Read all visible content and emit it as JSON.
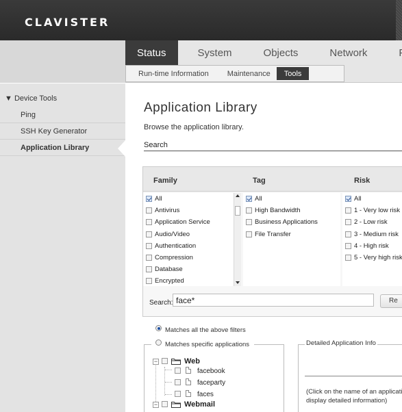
{
  "header": {
    "logo_text": "CLAVISTER"
  },
  "nav": {
    "main_tabs": [
      {
        "label": "Status",
        "active": true
      },
      {
        "label": "System",
        "active": false
      },
      {
        "label": "Objects",
        "active": false
      },
      {
        "label": "Network",
        "active": false
      },
      {
        "label": "Poli",
        "active": false
      }
    ],
    "sub_tabs": [
      {
        "label": "Run-time Information",
        "active": false
      },
      {
        "label": "Maintenance",
        "active": false
      },
      {
        "label": "Tools",
        "active": true
      }
    ]
  },
  "sidebar": {
    "section_title": "▼ Device Tools",
    "items": [
      {
        "label": "Ping",
        "active": false
      },
      {
        "label": "SSH Key Generator",
        "active": false
      },
      {
        "label": "Application Library",
        "active": true
      }
    ]
  },
  "main": {
    "title": "Application Library",
    "description": "Browse the application library.",
    "search_label": "Search"
  },
  "filters": {
    "columns": [
      {
        "header": "Family"
      },
      {
        "header": "Tag"
      },
      {
        "header": "Risk"
      }
    ],
    "family": [
      {
        "label": "All",
        "checked": true
      },
      {
        "label": "Antivirus",
        "checked": false
      },
      {
        "label": "Application Service",
        "checked": false
      },
      {
        "label": "Audio/Video",
        "checked": false
      },
      {
        "label": "Authentication",
        "checked": false
      },
      {
        "label": "Compression",
        "checked": false
      },
      {
        "label": "Database",
        "checked": false
      },
      {
        "label": "Encrypted",
        "checked": false
      }
    ],
    "tag": [
      {
        "label": "All",
        "checked": true
      },
      {
        "label": "High Bandwidth",
        "checked": false
      },
      {
        "label": "Business Applications",
        "checked": false
      },
      {
        "label": "File Transfer",
        "checked": false
      }
    ],
    "risk": [
      {
        "label": "All",
        "checked": true
      },
      {
        "label": "1 - Very low risk",
        "checked": false
      },
      {
        "label": "2 - Low risk",
        "checked": false
      },
      {
        "label": "3 - Medium risk",
        "checked": false
      },
      {
        "label": "4 - High risk",
        "checked": false
      },
      {
        "label": "5 - Very high risk",
        "checked": false
      }
    ],
    "search_label": "Search:",
    "search_value": "face*",
    "reset_label": "Re"
  },
  "matching": {
    "option_all_label": "Matches all the above filters",
    "option_all_selected": true,
    "option_specific_label": "Matches specific applications",
    "option_specific_selected": false
  },
  "tree": {
    "groups": [
      {
        "label": "Web",
        "children": [
          "facebook",
          "faceparty",
          "faces"
        ]
      },
      {
        "label": "Webmail",
        "children": []
      }
    ]
  },
  "details": {
    "legend": "Detailed Application Info",
    "hint_line1": "(Click on the name of an applicati",
    "hint_line2": "display detailed information)"
  }
}
